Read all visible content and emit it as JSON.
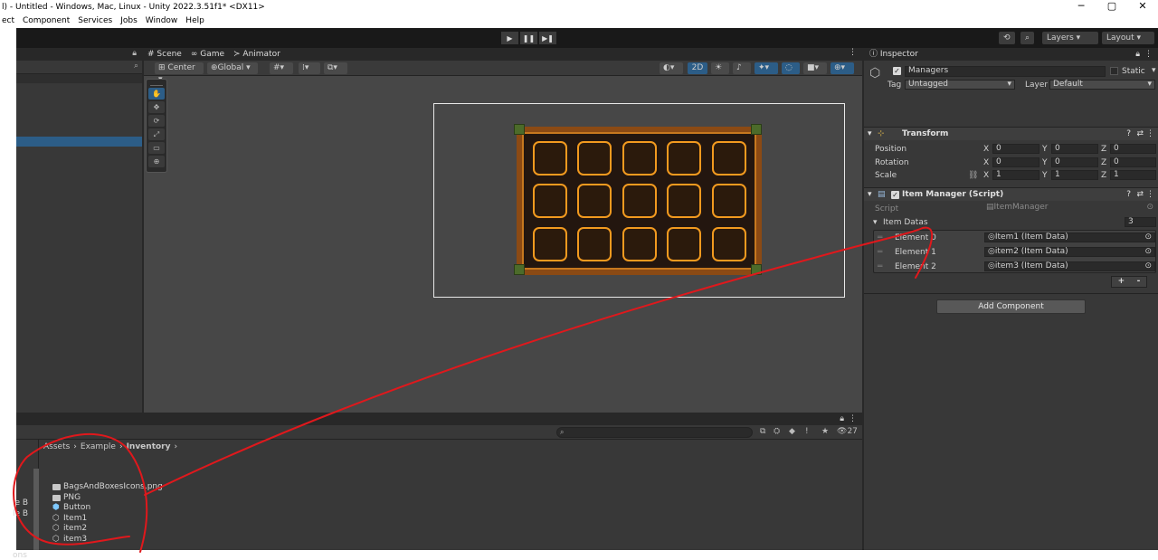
{
  "window": {
    "title": "l) - Untitled - Windows, Mac, Linux - Unity 2022.3.51f1* <DX11>",
    "minimize": "─",
    "maximize": "▢",
    "close": "✕"
  },
  "menu": [
    "ect",
    "Component",
    "Services",
    "Jobs",
    "Window",
    "Help"
  ],
  "toolbar": {
    "layers": "Layers",
    "layout": "Layout"
  },
  "scene": {
    "tabs": {
      "scene": "Scene",
      "game": "Game",
      "animator": "Animator"
    },
    "pivot": "Center",
    "space": "Global",
    "mode2d": "2D",
    "grid": {
      "rows": 3,
      "cols": 5
    }
  },
  "inspector": {
    "tab": "Inspector",
    "object_name": "Managers",
    "static_label": "Static",
    "tag_label": "Tag",
    "tag_value": "Untagged",
    "layer_label": "Layer",
    "layer_value": "Default",
    "transform": {
      "title": "Transform",
      "rows": [
        {
          "label": "Position",
          "x": "0",
          "y": "0",
          "z": "0"
        },
        {
          "label": "Rotation",
          "x": "0",
          "y": "0",
          "z": "0"
        },
        {
          "label": "Scale",
          "x": "1",
          "y": "1",
          "z": "1"
        }
      ]
    },
    "axis": {
      "x": "X",
      "y": "Y",
      "z": "Z"
    },
    "script_comp": {
      "title": "Item Manager (Script)",
      "script_label": "Script",
      "script_value": "ItemManager",
      "list_label": "Item Datas",
      "list_count": "3",
      "elements": [
        {
          "label": "Element 0",
          "value": "Item1 (Item Data)"
        },
        {
          "label": "Element 1",
          "value": "item2 (Item Data)"
        },
        {
          "label": "Element 2",
          "value": "item3 (Item Data)"
        }
      ],
      "plus": "+",
      "minus": "-"
    },
    "add_component": "Add Component"
  },
  "project": {
    "breadcrumb": [
      "Assets",
      "Example",
      "Inventory"
    ],
    "count": "27",
    "left_labels": [
      "le B",
      "le B",
      "ons"
    ],
    "assets": [
      {
        "name": "BagsAndBoxesIcons.png",
        "kind": "folder"
      },
      {
        "name": "PNG",
        "kind": "folder"
      },
      {
        "name": "Button",
        "kind": "prefab"
      },
      {
        "name": "Item1",
        "kind": "scriptable"
      },
      {
        "name": "item2",
        "kind": "scriptable"
      },
      {
        "name": "item3",
        "kind": "scriptable"
      }
    ]
  },
  "colors": {
    "annotation": "#e0181c",
    "selection": "#2c5d87",
    "slot_border": "#f29a1f"
  }
}
